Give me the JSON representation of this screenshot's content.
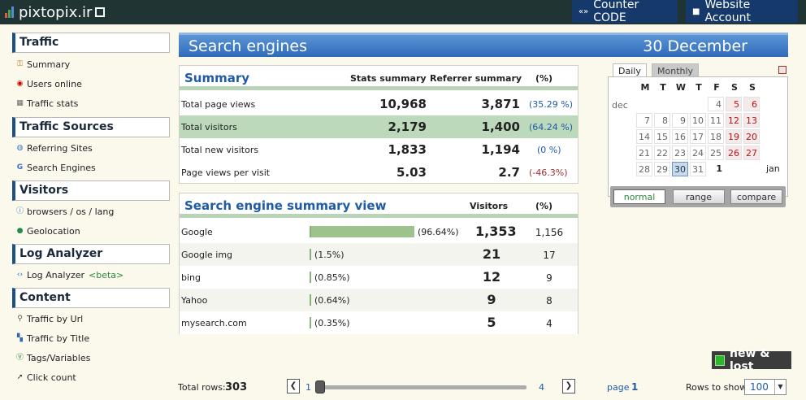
{
  "topbar": {
    "logo_text": "pixtopix.ir",
    "counter_code": "Counter CODE",
    "website_account": "Website Account"
  },
  "sidebar": {
    "sections": [
      {
        "title": "Traffic",
        "items": [
          "Summary",
          "Users online",
          "Traffic stats"
        ]
      },
      {
        "title": "Traffic Sources",
        "items": [
          "Referring Sites",
          "Search Engines"
        ]
      },
      {
        "title": "Visitors",
        "items": [
          "browsers / os / lang",
          "Geolocation"
        ]
      },
      {
        "title": "Log Analyzer",
        "items": [
          "Log Analyzer"
        ]
      },
      {
        "title": "Content",
        "items": [
          "Traffic by Url",
          "Traffic by Title",
          "Tags/Variables",
          "Click count"
        ]
      }
    ],
    "beta_label": "<beta>"
  },
  "header": {
    "title": "Search engines",
    "date": "30 December"
  },
  "summary": {
    "title": "Summary",
    "columns": [
      "Stats summary",
      "Referrer summary",
      "(%)"
    ],
    "rows": [
      {
        "label": "Total page views",
        "stats": "10,968",
        "referrer": "3,871",
        "pct": "(35.29 %)"
      },
      {
        "label": "Total visitors",
        "stats": "2,179",
        "referrer": "1,400",
        "pct": "(64.24 %)"
      },
      {
        "label": "Total new visitors",
        "stats": "1,833",
        "referrer": "1,194",
        "pct": "(0 %)"
      },
      {
        "label": "Page views per visit",
        "stats": "5.03",
        "referrer": "2.7",
        "pct": "(-46.3%)"
      }
    ]
  },
  "engines": {
    "title": "Search engine summary view",
    "columns": [
      "Visitors",
      "(%)"
    ],
    "rows": [
      {
        "name": "Google",
        "share": 0.9664,
        "share_label": "(96.64%)",
        "visitors": "1,353",
        "pct": "1,156"
      },
      {
        "name": "Google img",
        "share": 0.015,
        "share_label": "(1.5%)",
        "visitors": "21",
        "pct": "17"
      },
      {
        "name": "bing",
        "share": 0.0085,
        "share_label": "(0.85%)",
        "visitors": "12",
        "pct": "9"
      },
      {
        "name": "Yahoo",
        "share": 0.0064,
        "share_label": "(0.64%)",
        "visitors": "9",
        "pct": "8"
      },
      {
        "name": "mysearch.com",
        "share": 0.0035,
        "share_label": "(0.35%)",
        "visitors": "5",
        "pct": "4"
      }
    ]
  },
  "calendar": {
    "tabs": [
      "Daily",
      "Monthly"
    ],
    "weekdays": [
      "M",
      "T",
      "W",
      "T",
      "F",
      "S",
      "S"
    ],
    "prev_month": "dec",
    "next_month": "jan",
    "buttons": [
      "normal",
      "range",
      "compare"
    ]
  },
  "new_lost": "new & lost",
  "footer": {
    "total_rows_label": "Total rows:",
    "total_rows": "303",
    "slider_min": "1",
    "slider_max": "4",
    "slider_value": 1,
    "page_label": "page",
    "page": "1",
    "rows_to_show_label": "Rows to show",
    "rows_to_show": "100"
  },
  "colors": {
    "accent": "#1f5ba6",
    "header": "#2e6bbb",
    "highlight": "#bcd9bb",
    "bar": "#9dc28b"
  }
}
